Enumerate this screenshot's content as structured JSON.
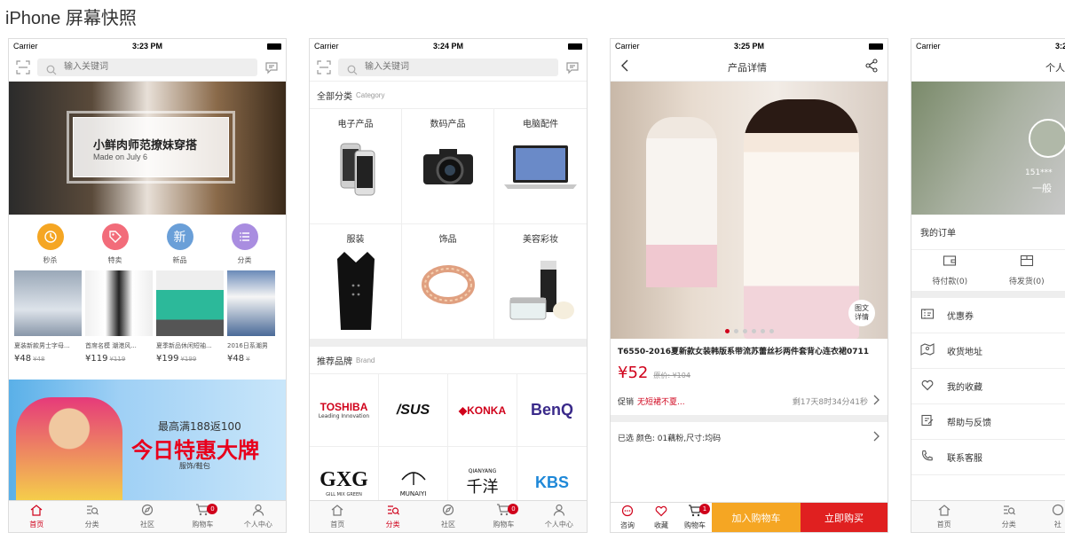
{
  "page": {
    "title": "iPhone 屏幕快照"
  },
  "status": {
    "carrier": "Carrier",
    "times": [
      "3:23 PM",
      "3:24 PM",
      "3:25 PM",
      "3:2"
    ]
  },
  "search": {
    "placeholder": "输入关键词"
  },
  "tabs": {
    "home": "首页",
    "category": "分类",
    "community": "社区",
    "cart": "购物车",
    "profile": "个人中心",
    "cart_badge": "0",
    "profile_short": "个"
  },
  "home": {
    "banner_title": "小鲜肉师范撩妹穿搭",
    "banner_sub": "Made on July 6",
    "quick": [
      {
        "label": "秒杀",
        "icon": "clock-icon",
        "color": "#f5a623"
      },
      {
        "label": "特卖",
        "icon": "tag-icon",
        "color": "#f26c7a"
      },
      {
        "label": "新品",
        "icon": "new-icon",
        "glyph": "新",
        "color": "#6a9fd8"
      },
      {
        "label": "分类",
        "icon": "list-icon",
        "color": "#a98de0"
      }
    ],
    "products": [
      {
        "name": "夏装新款男士字母...",
        "price": "¥48",
        "orig": "¥48"
      },
      {
        "name": "首席名模 潮港风...",
        "price": "¥119",
        "orig": "¥119"
      },
      {
        "name": "夏季新品休闲短袖...",
        "price": "¥199",
        "orig": "¥199"
      },
      {
        "name": "2016日系潮男",
        "price": "¥48",
        "orig": "¥"
      }
    ],
    "promo_line1": "最高满188返100",
    "promo_line2": "今日特惠大牌",
    "promo_line3": "服饰/鞋包"
  },
  "category": {
    "all_label": "全部分类",
    "all_sub": "Category",
    "items": [
      "电子产品",
      "数码产品",
      "电脑配件",
      "服装",
      "饰品",
      "美容彩妆"
    ],
    "brand_label": "推荐品牌",
    "brand_sub": "Brand",
    "brands": [
      {
        "name": "TOSHIBA",
        "sub": "Leading Innovation",
        "color": "#d0021b"
      },
      {
        "name": "/SUS",
        "color": "#111"
      },
      {
        "name": "KONKA",
        "color": "#d0021b"
      },
      {
        "name": "BenQ",
        "color": "#3a2a8a"
      },
      {
        "name": "GXG",
        "sub": "GILL MIX GREEN",
        "color": "#111"
      },
      {
        "name": "MUNAIYI",
        "color": "#111"
      },
      {
        "name": "千洋",
        "sub": "QIANYANG",
        "color": "#111"
      },
      {
        "name": "KBS",
        "color": "#1e88d8"
      }
    ]
  },
  "detail": {
    "nav_title": "产品详情",
    "badge_line1": "图文",
    "badge_line2": "详情",
    "title": "T6550-2016夏新款女装韩版系带流苏蕾丝衫两件套背心连衣裙0711",
    "price": "¥52",
    "orig_price": "原价: ¥104",
    "promo_label": "促销",
    "promo_text": "无短裙不夏...",
    "countdown": "剩17天8时34分41秒",
    "selected": "已选 颜色: 01藕粉,尺寸:均码",
    "btn_consult": "咨询",
    "btn_fav": "收藏",
    "btn_cart_label": "购物车",
    "cart_count": "1",
    "add_cart": "加入购物车",
    "buy_now": "立即购买"
  },
  "profile": {
    "nav_title": "个人",
    "phone_masked": "151***",
    "level": "一般",
    "orders_label": "我的订单",
    "pending_pay": "待付款(0)",
    "pending_ship": "待发货(0)",
    "menu": [
      {
        "label": "优惠券",
        "icon": "coupon-icon"
      },
      {
        "label": "收货地址",
        "icon": "map-icon"
      },
      {
        "label": "我的收藏",
        "icon": "heart-icon"
      },
      {
        "label": "帮助与反馈",
        "icon": "edit-icon"
      },
      {
        "label": "联系客服",
        "icon": "phone-icon"
      }
    ],
    "tab_short": "社"
  }
}
